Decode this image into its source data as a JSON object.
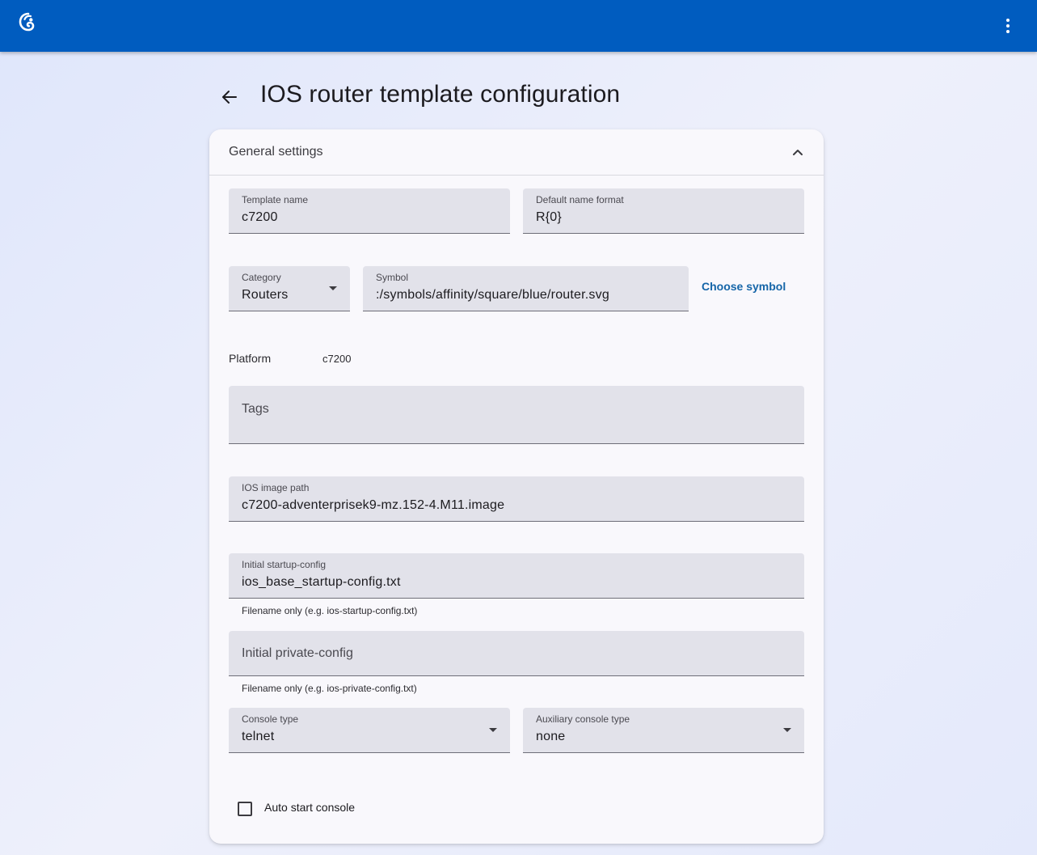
{
  "header": {
    "logo_icon": "chameleon-logo-icon",
    "menu_icon": "more-vertical-icon",
    "bar_color": "#005cbf"
  },
  "page": {
    "title": "IOS router template configuration",
    "back_icon": "arrow-left-icon"
  },
  "panel": {
    "title": "General settings",
    "toggle_icon": "chevron-up-icon"
  },
  "form": {
    "template_name": {
      "label": "Template name",
      "value": "c7200"
    },
    "default_name_format": {
      "label": "Default name format",
      "value": "R{0}"
    },
    "category": {
      "label": "Category",
      "value": "Routers"
    },
    "symbol": {
      "label": "Symbol",
      "value": ":/symbols/affinity/square/blue/router.svg"
    },
    "choose_symbol_label": "Choose symbol",
    "platform": {
      "label": "Platform",
      "value": "c7200"
    },
    "tags": {
      "placeholder": "Tags"
    },
    "ios_image_path": {
      "label": "IOS image path",
      "value": "c7200-adventerprisek9-mz.152-4.M11.image"
    },
    "startup_config": {
      "label": "Initial startup-config",
      "value": "ios_base_startup-config.txt",
      "hint": "Filename only (e.g. ios-startup-config.txt)"
    },
    "private_config": {
      "placeholder": "Initial private-config",
      "hint": "Filename only (e.g. ios-private-config.txt)"
    },
    "console_type": {
      "label": "Console type",
      "value": "telnet"
    },
    "aux_console_type": {
      "label": "Auxiliary console type",
      "value": "none"
    },
    "auto_start_console": {
      "label": "Auto start console",
      "checked": false
    }
  }
}
